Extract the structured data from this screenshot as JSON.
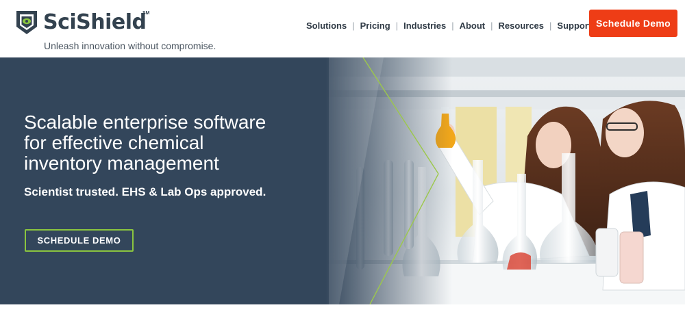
{
  "brand": {
    "name": "SciShield",
    "trademark": "SM",
    "tagline": "Unleash innovation without compromise."
  },
  "nav": {
    "items": [
      {
        "label": "Solutions"
      },
      {
        "label": "Pricing"
      },
      {
        "label": "Industries"
      },
      {
        "label": "About"
      },
      {
        "label": "Resources"
      },
      {
        "label": "Support"
      }
    ],
    "separator": "|"
  },
  "header_cta": {
    "label": "Schedule Demo"
  },
  "hero": {
    "title_lines": [
      "Scalable enterprise software",
      "for effective chemical",
      "inventory management"
    ],
    "subtitle": "Scientist trusted. EHS & Lab Ops approved.",
    "cta_label": "SCHEDULE DEMO"
  },
  "colors": {
    "brand_dark": "#33424f",
    "brand_green": "#8bc53f",
    "cta_orange": "#ee3d16",
    "hero_panel": "#33465b"
  },
  "icons": {
    "logo": "shield-logo-icon"
  }
}
